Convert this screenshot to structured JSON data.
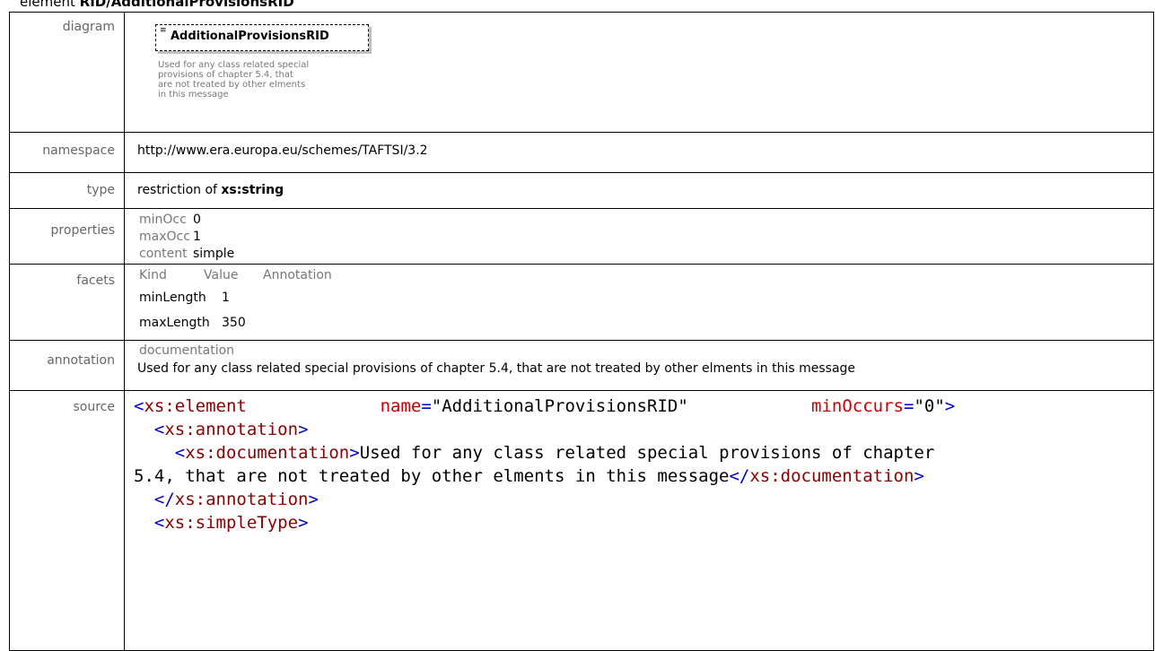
{
  "heading": {
    "prefix": "element",
    "name": "RID/AdditionalProvisionsRID"
  },
  "labels": {
    "diagram": "diagram",
    "namespace": "namespace",
    "type": "type",
    "properties": "properties",
    "facets": "facets",
    "annotation": "annotation",
    "source": "source"
  },
  "diagram": {
    "element_name": "AdditionalProvisionsRID",
    "doc": "Used for any class related special provisions of chapter 5.4, that are not treated by other elments in this message",
    "doc_lines": [
      "Used for any class related special",
      "provisions of chapter 5.4, that",
      "are not treated by other elments",
      "in this message"
    ]
  },
  "namespace": "http://www.era.europa.eu/schemes/TAFTSI/3.2",
  "type": {
    "prefix": "restriction of",
    "base": "xs:string"
  },
  "properties": [
    {
      "key": "minOcc",
      "value": "0"
    },
    {
      "key": "maxOcc",
      "value": "1"
    },
    {
      "key": "content",
      "value": "simple"
    }
  ],
  "facets": {
    "headers": [
      "Kind",
      "Value",
      "Annotation"
    ],
    "rows": [
      {
        "kind": "minLength",
        "value": "1"
      },
      {
        "kind": "maxLength",
        "value": "350"
      }
    ]
  },
  "annotation": {
    "header": "documentation",
    "text": "Used for any class related special provisions of chapter 5.4, that are not treated by other elments in this message"
  },
  "source": {
    "line1": {
      "open": "<",
      "tag": "xs:element",
      "attr1": "name",
      "val1": "\"AdditionalProvisionsRID\"",
      "attr2": "minOccurs",
      "val2": "\"0\"",
      "close": ">"
    },
    "line2": {
      "open": "<",
      "tag": "xs:annotation",
      "close": ">"
    },
    "line3": {
      "open": "<",
      "tag": "xs:documentation",
      "close": ">",
      "text": "Used for any class related special provisions of chapter"
    },
    "line4": {
      "text": "5.4, that are not treated by other elments in this message",
      "open": "</",
      "tag": "xs:documentation",
      "close": ">"
    },
    "line5": {
      "open": "</",
      "tag": "xs:annotation",
      "close": ">"
    },
    "line6": {
      "open": "<",
      "tag": "xs:simpleType",
      "close": ">"
    }
  }
}
